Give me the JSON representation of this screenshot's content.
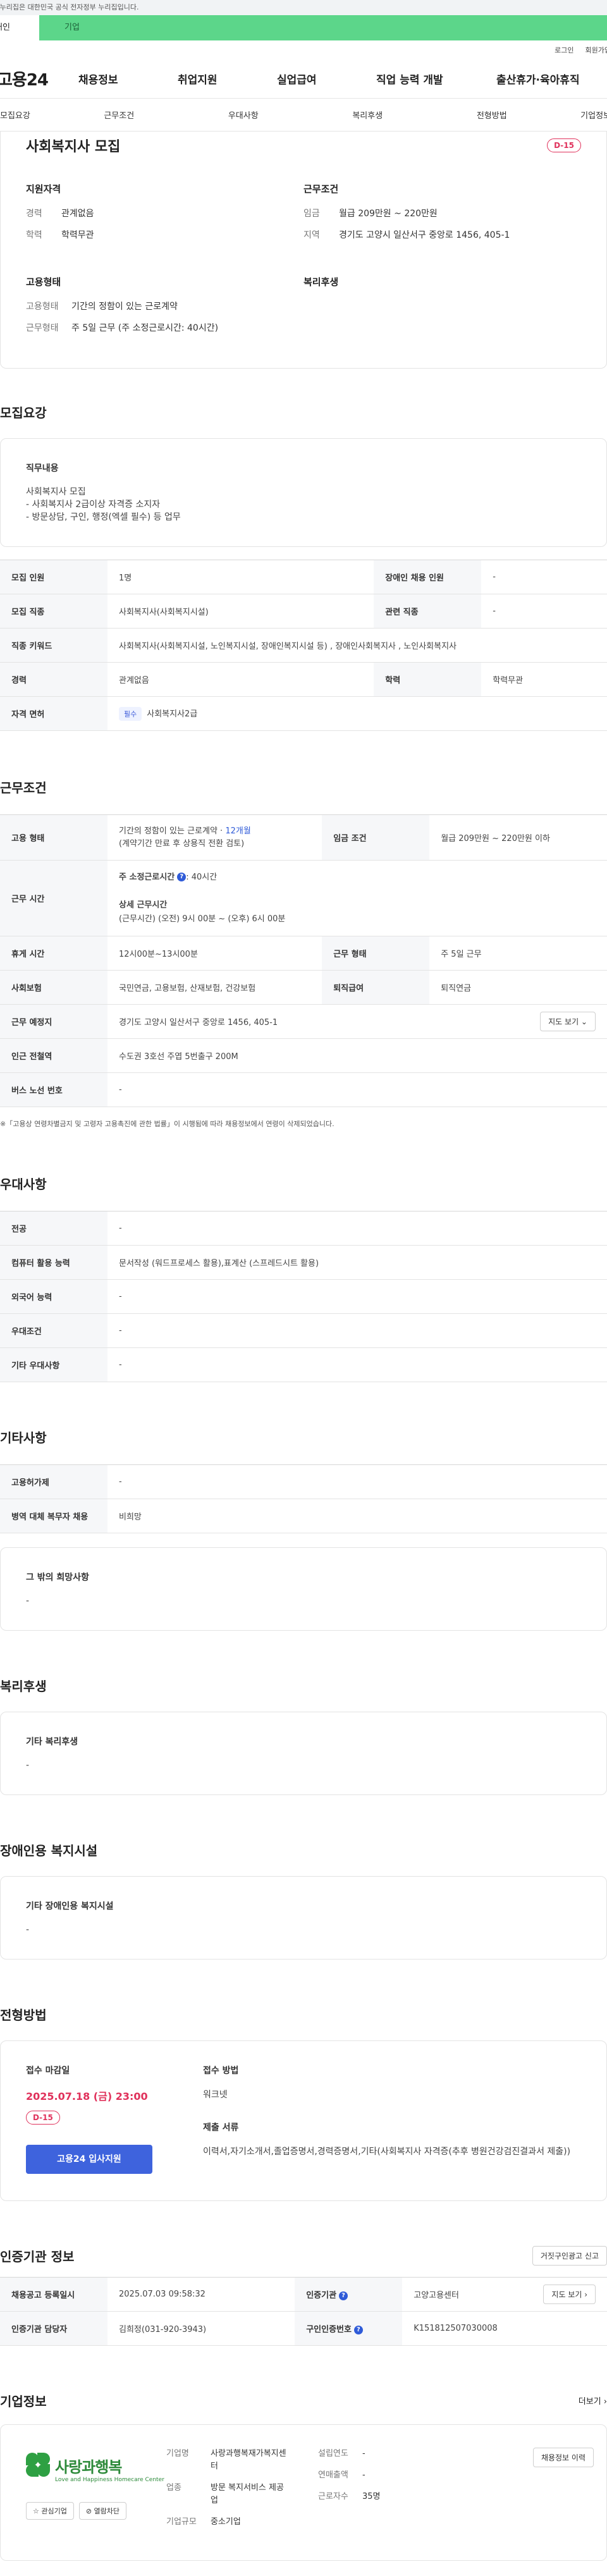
{
  "gov_notice": "이 누리집은 대한민국 공식 전자정부 누리집입니다.",
  "tabs": [
    "개인",
    "기업"
  ],
  "util": [
    "로그인",
    "회원가입"
  ],
  "logo": "고용24",
  "gnb": [
    "채용정보",
    "취업지원",
    "실업급여",
    "직업 능력 개발",
    "출산휴가·육아휴직"
  ],
  "lnb": [
    "모집요강",
    "근무조건",
    "우대사항",
    "복리후생",
    "전형방법",
    "기업정보"
  ],
  "summary": {
    "title": "사회복지사 모집",
    "dday": "D-15",
    "qualification": {
      "heading": "지원자격",
      "career_k": "경력",
      "career_v": "관계없음",
      "edu_k": "학력",
      "edu_v": "학력무관"
    },
    "conditions": {
      "heading": "근무조건",
      "wage_k": "임금",
      "wage_v": "월급 209만원 ~ 220만원",
      "area_k": "지역",
      "area_v": "경기도 고양시 일산서구 중앙로 1456, 405-1"
    },
    "employment": {
      "heading": "고용형태",
      "type_k": "고용형태",
      "type_v": "기간의 정함이 있는 근로계약",
      "shift_k": "근무형태",
      "shift_v": "주 5일 근무 (주 소정근로시간: 40시간)"
    },
    "welfare_heading": "복리후생"
  },
  "recruit": {
    "title": "모집요강",
    "duty_h": "직무내용",
    "duty_v": "사회복지사 모집\n-  사회복지사 2급이상 자격증 소지자\n-  방문상담, 구인, 행정(엑셀 필수) 등 업무",
    "rows": {
      "count_k": "모집 인원",
      "count_v": "1명",
      "disabled_k": "장애인 채용 인원",
      "disabled_v": "-",
      "job_k": "모집 직종",
      "job_v": "사회복지사(사회복지시설)",
      "rel_k": "관련 직종",
      "rel_v": "-",
      "kw_k": "직종 키워드",
      "kw_v": "사회복지사(사회복지시설, 노인복지시설, 장애인복지시설 등) , 장애인사회복지사 , 노인사회복지사",
      "career_k": "경력",
      "career_v": "관계없음",
      "edu_k": "학력",
      "edu_v": "학력무관",
      "lic_k": "자격 면허",
      "lic_tag": "필수",
      "lic_v": "사회복지사2급"
    }
  },
  "work": {
    "title": "근무조건",
    "type_k": "고용 형태",
    "type_v1": "기간의 정함이 있는 근로계약 · ",
    "type_months": "12개월",
    "type_v2": "(계약기간 만료 후 상용직 전환 검토)",
    "wage_k": "임금 조건",
    "wage_v": "월급 209만원 ~ 220만원 이하",
    "hours_k": "근무 시간",
    "hours_h1": "주 소정근로시간",
    "hours_q": "?",
    "hours_v1": ": 40시간",
    "hours_h2": "상세 근무시간",
    "hours_v2": "(근무시간) (오전) 9시 00분 ~ (오후) 6시 00분",
    "rest_k": "휴게 시간",
    "rest_v": "12시00분~13시00분",
    "shift_k": "근무 형태",
    "shift_v": "주 5일 근무",
    "ins_k": "사회보험",
    "ins_v": "국민연금, 고용보험, 산재보험, 건강보험",
    "ret_k": "퇴직급여",
    "ret_v": "퇴직연금",
    "place_k": "근무 예정지",
    "place_v": "경기도 고양시 일산서구 중앙로 1456, 405-1",
    "map_btn": "지도 보기 ⌄",
    "subway_k": "인근 전철역",
    "subway_v": "수도권 3호선 주엽 5번출구 200M",
    "bus_k": "버스 노선 번호",
    "bus_v": "-",
    "note": "※「고용상 연령차별금지 및 고령자 고용촉진에 관한 법률」이 시행됨에 따라 채용정보에서 연령이 삭제되었습니다."
  },
  "pref": {
    "title": "우대사항",
    "major_k": "전공",
    "major_v": "-",
    "pc_k": "컴퓨터 활용 능력",
    "pc_v": "문서작성 (워드프로세스 활용),표계산 (스프레드시트 활용)",
    "lang_k": "외국어 능력",
    "lang_v": "-",
    "cond_k": "우대조건",
    "cond_v": "-",
    "etc_k": "기타 우대사항",
    "etc_v": "-"
  },
  "other": {
    "title": "기타사항",
    "ins_k": "고용허가제",
    "ins_v": "-",
    "mil_k": "병역 대체 복무자 채용",
    "mil_v": "비희망",
    "wish_h": "그 밖의 희망사항",
    "wish_v": "-"
  },
  "welfare": {
    "title": "복리후생",
    "h": "기타 복리후생",
    "v": "-"
  },
  "facility": {
    "title": "장애인용 복지시설",
    "h": "기타 장애인용 복지시설",
    "v": "-"
  },
  "process": {
    "title": "전형방법",
    "deadline_h": "접수 마감일",
    "deadline_v": "2025.07.18 (금) 23:00",
    "dday": "D-15",
    "apply_btn": "고용24 입사지원",
    "method_h": "접수 방법",
    "method_v": "워크넷",
    "docs_h": "제출 서류",
    "docs_v": "이력서,자기소개서,졸업증명서,경력증명서,기타(사회복지사 자격증(추후 병원건강검진결과서 제출))"
  },
  "agency": {
    "title": "인증기관 정보",
    "report_btn": "거짓구인광고 신고",
    "reg_k": "채용공고 등록일시",
    "reg_v": "2025.07.03 09:58:32",
    "org_k": "인증기관",
    "org_v": "고양고용센터",
    "map_btn": "지도 보기 ›",
    "mgr_k": "인증기관 담당자",
    "mgr_v": "김희정(031-920-3943)",
    "no_k": "구인인증번호",
    "no_v": "K151812507030008",
    "q": "?"
  },
  "company": {
    "title": "기업정보",
    "more": "더보기 ›",
    "logo_txt": "사랑과행복",
    "logo_sub": "Love and Happiness Homecare Center",
    "fav_btn": "☆ 관심기업",
    "block_btn": "⊘ 열람차단",
    "name_k": "기업명",
    "name_v": "사랑과행복재가복지센터",
    "ind_k": "업종",
    "ind_v": "방문 복지서비스 제공업",
    "size_k": "기업규모",
    "size_v": "중소기업",
    "year_k": "설립연도",
    "year_v": "-",
    "sales_k": "연매출액",
    "sales_v": "-",
    "emp_k": "근로자수",
    "emp_v": "35명",
    "jobs_btn": "채용정보 이력"
  }
}
